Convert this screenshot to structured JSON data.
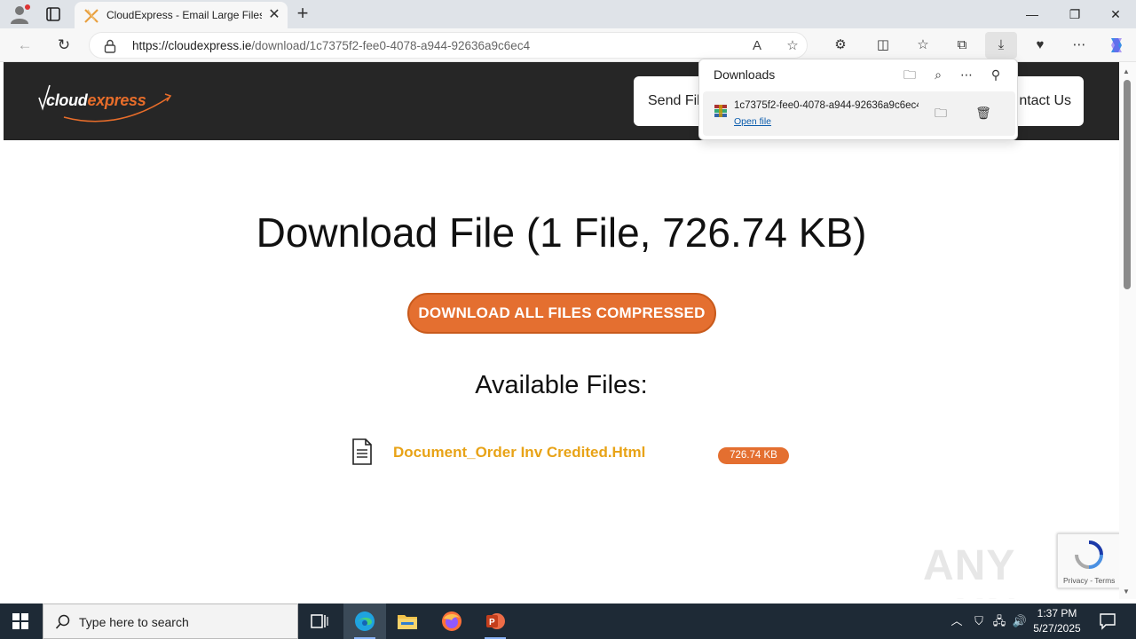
{
  "browser": {
    "tab_title": "CloudExpress - Email Large Files",
    "url_host": "https://cloudexpress.ie",
    "url_path": "/download/1c7375f2-fee0-4078-a944-92636a9c6ec4"
  },
  "site": {
    "logo_prefix": "cloud",
    "logo_suffix": "express",
    "nav_send": "Send Fil",
    "nav_contact": "ntact Us",
    "heading": "Download File (1 File, 726.74 KB)",
    "download_all_label": "DOWNLOAD ALL FILES COMPRESSED",
    "available_heading": "Available Files:",
    "files": [
      {
        "name": "Document_Order Inv Credited.Html",
        "size": "726.74 KB"
      }
    ],
    "recaptcha_links": "Privacy - Terms"
  },
  "downloads_panel": {
    "title": "Downloads",
    "item_filename": "1c7375f2-fee0-4078-a944-92636a9c6ec4",
    "item_action": "Open file"
  },
  "taskbar": {
    "search_placeholder": "Type here to search",
    "time": "1:37 PM",
    "date": "5/27/2025"
  },
  "watermark": "ANY RUN",
  "colors": {
    "accent_orange": "#e46f30",
    "file_link": "#e8a317",
    "header_bg": "#262626"
  }
}
